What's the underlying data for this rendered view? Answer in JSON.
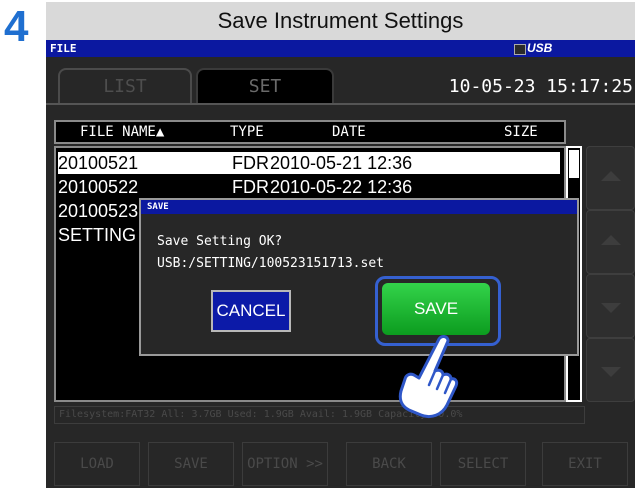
{
  "step_number": "4",
  "banner_title": "Save Instrument Settings",
  "titlebar": {
    "label": "FILE",
    "usb_label": "USB"
  },
  "tabs": {
    "list": "LIST",
    "set": "SET"
  },
  "datetime": "10-05-23 15:17:25",
  "file_list": {
    "columns": {
      "name": "FILE NAME▲",
      "type": "TYPE",
      "date": "DATE",
      "size": "SIZE"
    },
    "rows": [
      {
        "name": "20100521",
        "type": "FDR",
        "date": "2010-05-21 12:36"
      },
      {
        "name": "20100522",
        "type": "FDR",
        "date": "2010-05-22 12:36"
      },
      {
        "name": "20100523",
        "type": "",
        "date": ""
      },
      {
        "name": "SETTING",
        "type": "",
        "date": ""
      }
    ]
  },
  "status_text": "Filesystem:FAT32 All: 3.7GB Used: 1.9GB Avail: 1.9GB Capacity:50.0%",
  "bottom_buttons": [
    "LOAD",
    "SAVE",
    "OPTION >>",
    "BACK",
    "SELECT",
    "EXIT"
  ],
  "dialog": {
    "title": "SAVE",
    "message": "Save Setting OK?",
    "path": "USB:/SETTING/100523151713.set",
    "cancel_label": "CANCEL",
    "save_label": "SAVE"
  },
  "colors": {
    "step": "#1f6fd0",
    "titlebar": "#0b18a0",
    "cancel": "#0c1aa8",
    "save": "#1ab232",
    "highlight_frame": "#3560d0"
  }
}
